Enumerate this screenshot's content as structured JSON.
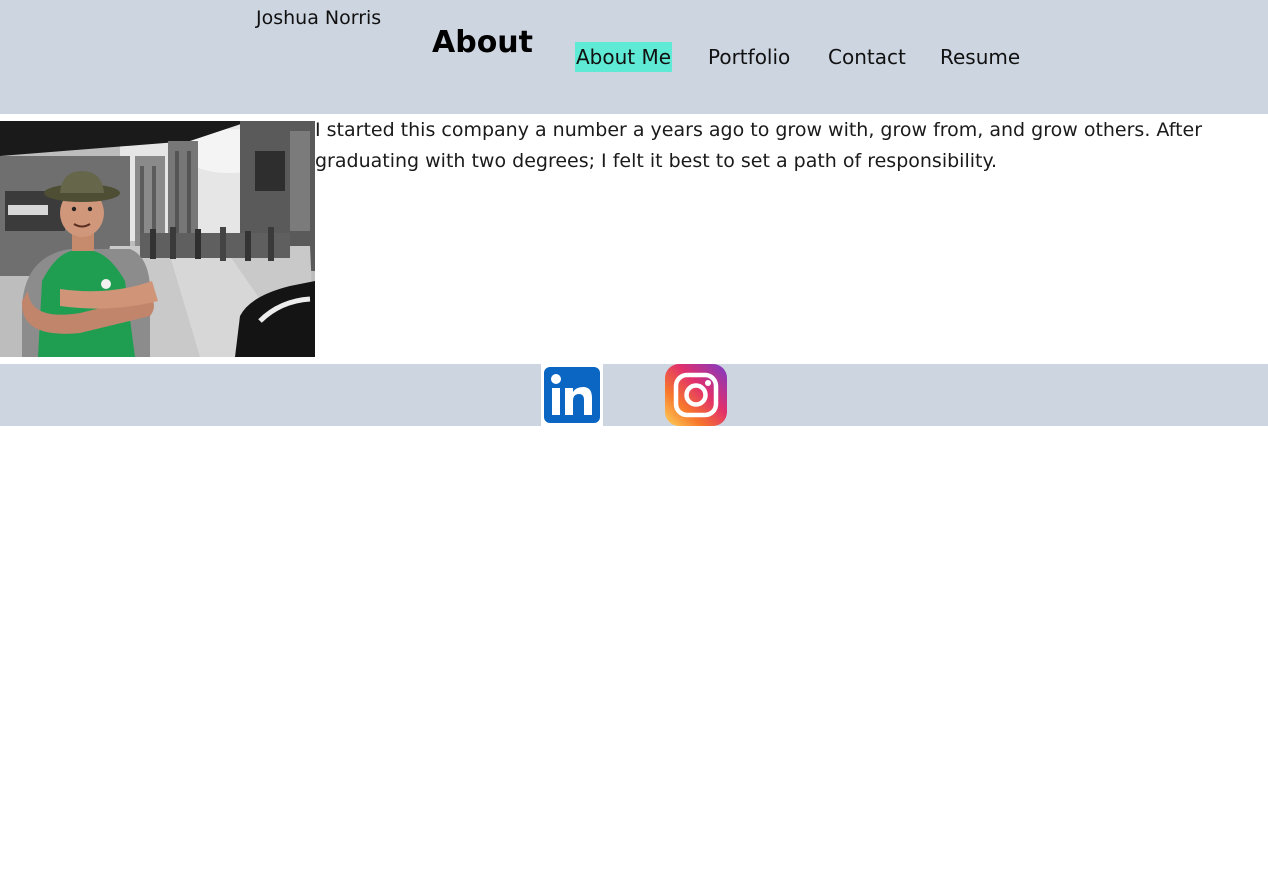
{
  "site": {
    "name": "Joshua Norris"
  },
  "page": {
    "heading": "About"
  },
  "nav": {
    "items": [
      {
        "label": "About Me",
        "active": true
      },
      {
        "label": "Portfolio",
        "active": false
      },
      {
        "label": "Contact",
        "active": false
      },
      {
        "label": "Resume",
        "active": false
      }
    ],
    "active_color": "#5eead4"
  },
  "theme": {
    "bar_color": "#cdd5e0"
  },
  "about": {
    "photo_icon": "profile-photo",
    "text": "I started this company a number a years ago to grow with, grow from, and grow others. After graduating with two degrees; I felt it best to set a path of responsibility."
  },
  "social": {
    "links": [
      {
        "icon": "linkedin-icon",
        "brand_color": "#0a66c2"
      },
      {
        "icon": "instagram-icon",
        "brand_color": "#e1306c"
      }
    ]
  }
}
